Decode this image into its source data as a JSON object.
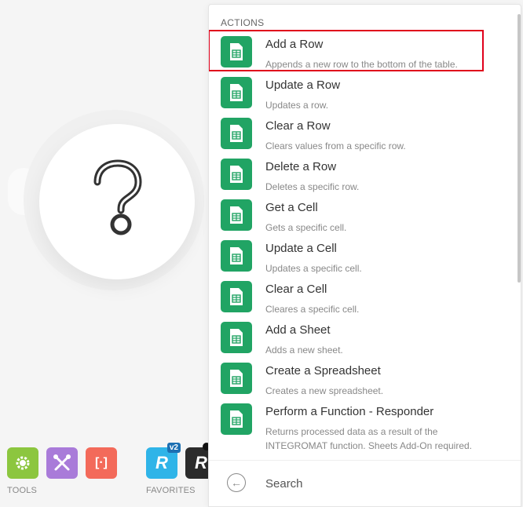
{
  "toolbar": {
    "tools_label": "TOOLS",
    "favorites_label": "FAVORITES",
    "bracket_glyph": "[·]",
    "fav_badge": "v2",
    "fav_letter": "R"
  },
  "module": {
    "icon": "question-mark-icon"
  },
  "panel": {
    "section_title": "ACTIONS",
    "items": [
      {
        "title": "Add a Row",
        "desc": "Appends a new row to the bottom of the table."
      },
      {
        "title": "Update a Row",
        "desc": "Updates a row."
      },
      {
        "title": "Clear a Row",
        "desc": "Clears values from a specific row."
      },
      {
        "title": "Delete a Row",
        "desc": "Deletes a specific row."
      },
      {
        "title": "Get a Cell",
        "desc": "Gets a specific cell."
      },
      {
        "title": "Update a Cell",
        "desc": "Updates a specific cell."
      },
      {
        "title": "Clear a Cell",
        "desc": "Cleares a specific cell."
      },
      {
        "title": "Add a Sheet",
        "desc": "Adds a new sheet."
      },
      {
        "title": "Create a Spreadsheet",
        "desc": "Creates a new spreadsheet."
      },
      {
        "title": "Perform a Function - Responder",
        "desc": "Returns processed data as a result of the INTEGROMAT function. Sheets Add-On required."
      }
    ],
    "search": {
      "placeholder": "Search",
      "value": ""
    }
  },
  "colors": {
    "accent_green": "#21a464",
    "selection_red": "#e0001b"
  }
}
